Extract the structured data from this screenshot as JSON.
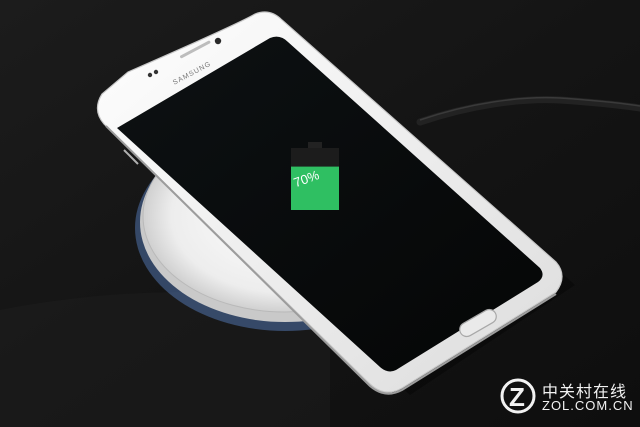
{
  "photo": {
    "subject": "phone-on-wireless-charger",
    "colors": {
      "background": "#151515",
      "phone_frame": "#f4f4f4",
      "screen": "#0a0d0e",
      "battery_fill": "#2fbf62",
      "charger_pad": "#f0f0f0",
      "charger_glow": "#6fa6ff",
      "cable": "#202020"
    }
  },
  "phone": {
    "brand": "SAMSUNG",
    "battery": {
      "percent_label": "70%",
      "level": 0.7
    }
  },
  "watermark": {
    "logo_letter": "Z",
    "cn_text": "中关村在线",
    "en_text": "ZOL.COM.CN"
  }
}
